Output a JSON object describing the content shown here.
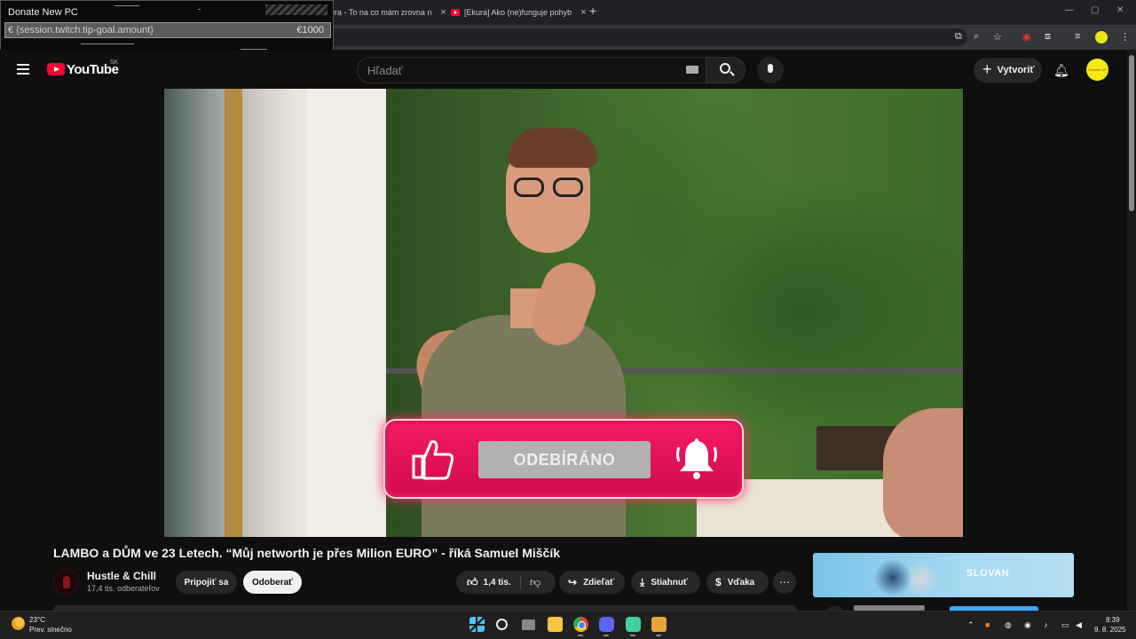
{
  "overlay": {
    "title": "Donate New PC",
    "expression": "€ {session.twitch.tip-goal.amount}",
    "goal": "€1000"
  },
  "browser": {
    "tabs": [
      {
        "label": "ura - To na co mám zrovna n"
      },
      {
        "label": "[Ekura] Ako (ne)funguje pohyb"
      }
    ],
    "new_tab": "+"
  },
  "youtube": {
    "logo_text": "YouTube",
    "country": "SK",
    "search_placeholder": "Hľadať",
    "create_label": "Vytvoriť",
    "avatar_text": "Transfer UP"
  },
  "video": {
    "overlay_label": "ODEBÍRÁNO",
    "title": "LAMBO a DŮM ve 23 Letech. “Můj networth je přes Milion EURO” - říká Samuel Miščík",
    "channel_name": "Hustle & Chill",
    "channel_subs": "17,4 tis. odberateľov",
    "join_label": "Pripojiť sa",
    "subscribe_label": "Odoberať",
    "likes": "1,4 tis.",
    "share_label": "Zdieľať",
    "download_label": "Stiahnuť",
    "thanks_label": "Vďaka"
  },
  "ad": {
    "brand": "SLOVAN"
  },
  "taskbar": {
    "weather_temp": "23°C",
    "weather_desc": "Prev. slnečno",
    "time": "8:39",
    "date": "9. 8. 2025"
  },
  "colors": {
    "yt_red": "#ff0033",
    "banner_pink": "#e3145a",
    "background": "#0f0f0f"
  }
}
